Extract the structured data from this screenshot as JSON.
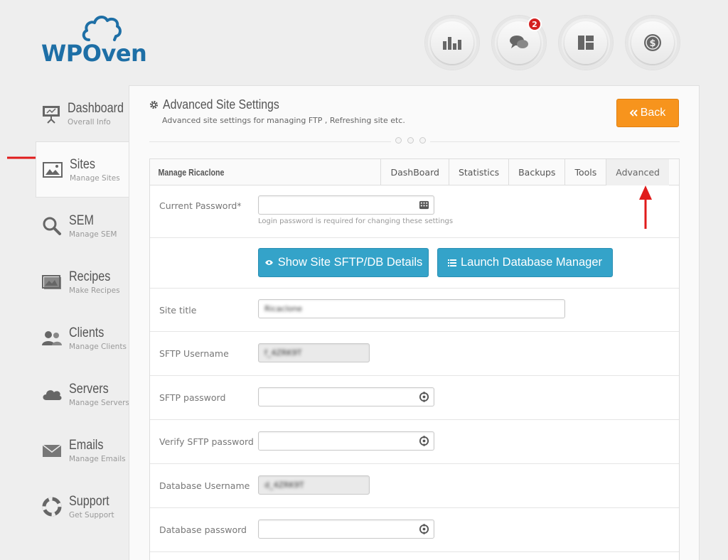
{
  "brand": {
    "name": "WPOven"
  },
  "top_icons": [
    {
      "icon": "chart-icon"
    },
    {
      "icon": "chat-bubbles-icon",
      "badge": "2"
    },
    {
      "icon": "layout-icon"
    },
    {
      "icon": "dollar-coin-icon"
    }
  ],
  "sidebar": {
    "items": [
      {
        "label": "Dashboard",
        "sub": "Overall Info",
        "icon": "presentation-icon"
      },
      {
        "label": "Sites",
        "sub": "Manage Sites",
        "icon": "image-icon"
      },
      {
        "label": "SEM",
        "sub": "Manage SEM",
        "icon": "magnifier-icon"
      },
      {
        "label": "Recipes",
        "sub": "Make Recipes",
        "icon": "picture-frame-icon"
      },
      {
        "label": "Clients",
        "sub": "Manage Clients",
        "icon": "users-icon"
      },
      {
        "label": "Servers",
        "sub": "Manage Servers",
        "icon": "cloud-icon"
      },
      {
        "label": "Emails",
        "sub": "Manage Emails",
        "icon": "envelope-icon"
      },
      {
        "label": "Support",
        "sub": "Get Support",
        "icon": "lifebuoy-icon"
      }
    ]
  },
  "header": {
    "title": "Advanced Site Settings",
    "subtitle": "Advanced site settings for managing FTP , Refreshing site etc.",
    "back_label": "Back"
  },
  "card": {
    "manage_label": "Manage Ricaclone",
    "tabs": [
      "DashBoard",
      "Statistics",
      "Backups",
      "Tools",
      "Advanced"
    ],
    "active_tab": "Advanced"
  },
  "form": {
    "current_password": {
      "label": "Current Password*",
      "value": "",
      "hint": "Login password is required for changing these settings"
    },
    "buttons": {
      "sftp_details": "Show Site SFTP/DB Details",
      "db_manager": "Launch Database Manager"
    },
    "site_title": {
      "label": "Site title",
      "value": "Ricaclone"
    },
    "sftp_username": {
      "label": "SFTP Username",
      "value": "f_4ZRK9T"
    },
    "sftp_password": {
      "label": "SFTP password",
      "value": ""
    },
    "verify_sftp_password": {
      "label": "Verify SFTP password",
      "value": ""
    },
    "db_username": {
      "label": "Database Username",
      "value": "d_4ZRK9T"
    },
    "db_password": {
      "label": "Database password",
      "value": ""
    }
  },
  "colors": {
    "brand": "#1e6fa6",
    "back_button": "#f7941d",
    "action_button": "#34a3c9",
    "annotation_arrow": "#e01b1b",
    "badge": "#d42121"
  }
}
